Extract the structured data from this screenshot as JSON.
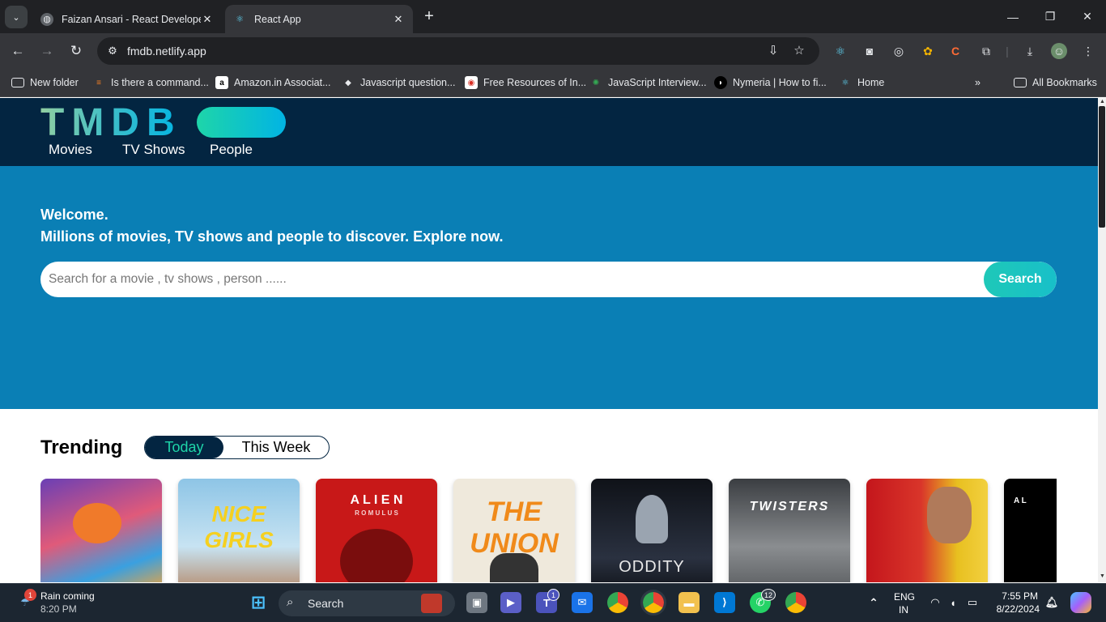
{
  "browser": {
    "tabs": [
      {
        "title": "Faizan Ansari - React Developer",
        "active": false
      },
      {
        "title": "React App",
        "active": true
      }
    ],
    "url": "fmdb.netlify.app",
    "bookmarks": [
      "New folder",
      "Is there a command...",
      "Amazon.in Associat...",
      "Javascript question...",
      "Free Resources of In...",
      "JavaScript Interview...",
      "Nymeria | How to fi...",
      "Home"
    ],
    "all_bookmarks": "All Bookmarks"
  },
  "site": {
    "logo": "TMDB",
    "nav": [
      "Movies",
      "TV Shows",
      "People"
    ],
    "hero": {
      "welcome": "Welcome.",
      "tagline": "Millions of movies, TV shows and people to discover. Explore now.",
      "search_placeholder": "Search for a movie , tv shows , person ......",
      "search_button": "Search"
    },
    "trending": {
      "title": "Trending",
      "options": [
        "Today",
        "This Week"
      ],
      "selected": "Today"
    },
    "posters": [
      {
        "text": "",
        "bg": "#5b2a86"
      },
      {
        "text": "NICE GIRLS",
        "bg": "#7fb7d6"
      },
      {
        "text": "A L I E N",
        "sub": "R O M U L U S",
        "bg": "#c81818"
      },
      {
        "text": "THE UNION",
        "bg": "#efe9dc"
      },
      {
        "text": "ODDITY",
        "bg": "#1a1d24"
      },
      {
        "text": "TWISTERS",
        "bg": "#55585c"
      },
      {
        "text": "",
        "bg": "#c4161c"
      },
      {
        "text": "A L",
        "bg": "#000000"
      }
    ]
  },
  "taskbar": {
    "weather_title": "Rain coming",
    "weather_time": "8:20 PM",
    "weather_badge": "1",
    "search_label": "Search",
    "teams_badge": "1",
    "whatsapp_badge": "12",
    "lang_top": "ENG",
    "lang_bottom": "IN",
    "time": "7:55 PM",
    "date": "8/22/2024"
  },
  "colors": {
    "tmdb_dark": "#032541",
    "hero_blue": "#0a7fb5",
    "accent_green": "#1ed5a9"
  }
}
